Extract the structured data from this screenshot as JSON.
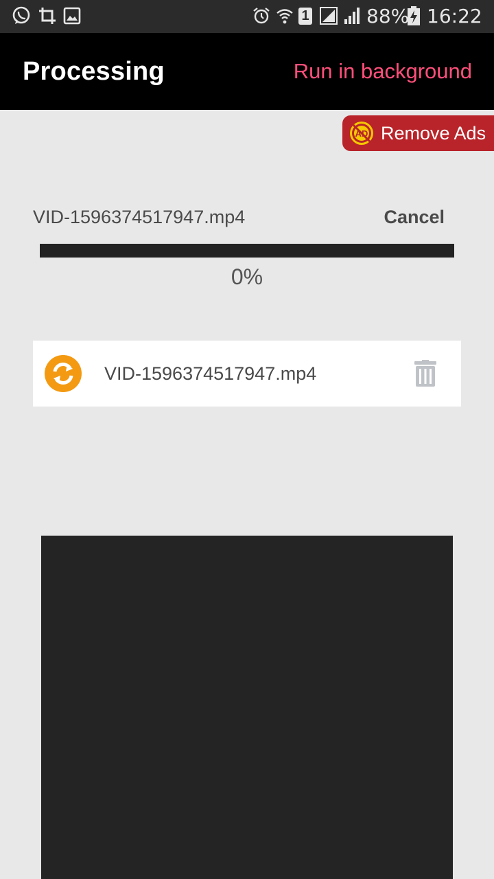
{
  "status_bar": {
    "battery_percent": "88%",
    "time": "16:22",
    "sim_slot": "1",
    "left_icons": [
      "whatsapp-icon",
      "crop-icon",
      "gallery-icon"
    ],
    "right_icons": [
      "alarm-icon",
      "wifi-icon",
      "sim-icon",
      "signal-icon",
      "signal-icon",
      "battery-charging-icon"
    ]
  },
  "app_bar": {
    "title": "Processing",
    "action_label": "Run in background",
    "action_color": "#ff4f7b"
  },
  "remove_ads": {
    "label": "Remove Ads",
    "icon": "no-ads-icon",
    "badge_text": "AD",
    "color": "#b8242a"
  },
  "current_task": {
    "file_name": "VID-1596374517947.mp4",
    "cancel_label": "Cancel",
    "progress": 0,
    "progress_text": "0%"
  },
  "queue": {
    "items": [
      {
        "file_name": "VID-1596374517947.mp4",
        "status_icon": "sync-icon",
        "delete_icon": "trash-icon"
      }
    ]
  },
  "colors": {
    "accent": "#f39a12",
    "background": "#e8e8e8",
    "app_bar": "#000000"
  }
}
